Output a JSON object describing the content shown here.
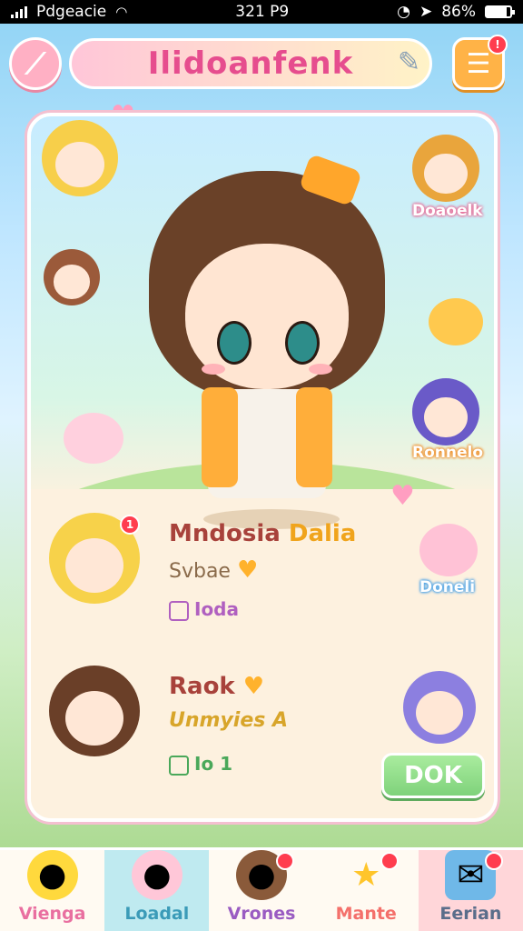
{
  "status_bar": {
    "carrier": "Pdgeacie",
    "time": "321 P9",
    "battery": "86%",
    "battery_level": 0.86
  },
  "header": {
    "title": "Ilidoanfenk"
  },
  "notifications_badge": "!",
  "side_labels": {
    "top_right": "Doaoelk",
    "mid_right": "Ronnelo",
    "low_right": "Doneli"
  },
  "entries": [
    {
      "name": "Mndosia",
      "name_accent": "Dalia",
      "sub": "Svbae",
      "tag": "Ioda",
      "badge": "1"
    },
    {
      "name": "Raok",
      "name_accent": "",
      "sub": "Unmyies A",
      "tag": "Io 1"
    }
  ],
  "ok_button": "DOK",
  "nav": [
    {
      "label": "Vienga",
      "color": "#e96fa0"
    },
    {
      "label": "Loadal",
      "color": "#3b9bb8"
    },
    {
      "label": "Vrones",
      "color": "#9a5cc2"
    },
    {
      "label": "Mante",
      "color": "#f4706b"
    },
    {
      "label": "Eerian",
      "color": "#5a6d8a"
    }
  ],
  "colors": {
    "title_pink": "#e64d8e",
    "ok_green": "#7fd27b"
  }
}
